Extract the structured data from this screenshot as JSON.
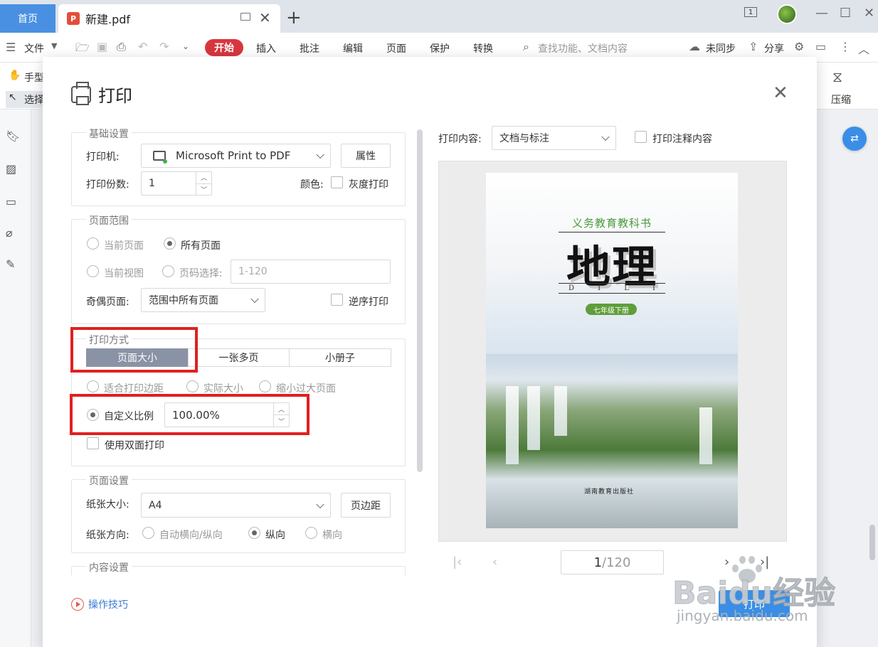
{
  "tabs": {
    "home": "首页",
    "doc_title": "新建.pdf",
    "pdf_icon": "P",
    "tab_count": "1"
  },
  "menu": {
    "file": "文件",
    "start": "开始",
    "items": [
      "插入",
      "批注",
      "编辑",
      "页面",
      "保护",
      "转换"
    ],
    "search_placeholder": "查找功能、文档内容",
    "sync": "未同步",
    "share": "分享"
  },
  "ribbon": {
    "hand": "手型",
    "select": "选择",
    "compress": "压缩"
  },
  "dialog": {
    "title": "打印",
    "basic": {
      "label": "基础设置",
      "printer_label": "打印机:",
      "printer_value": "Microsoft Print to PDF",
      "properties_button": "属性",
      "copies_label": "打印份数:",
      "copies_value": "1",
      "color_label": "颜色:",
      "grayscale": "灰度打印"
    },
    "range": {
      "label": "页面范围",
      "current_page": "当前页面",
      "all_pages": "所有页面",
      "current_view": "当前视图",
      "page_select": "页码选择:",
      "page_select_placeholder": "1-120",
      "odd_even_label": "奇偶页面:",
      "odd_even_value": "范围中所有页面",
      "reverse": "逆序打印"
    },
    "mode": {
      "label": "打印方式",
      "seg_page_size": "页面大小",
      "seg_multi": "一张多页",
      "seg_booklet": "小册子",
      "fit_margin": "适合打印边距",
      "actual_size": "实际大小",
      "shrink": "缩小过大页面",
      "custom_scale": "自定义比例",
      "scale_value": "100.00%",
      "duplex": "使用双面打印"
    },
    "page_setup": {
      "label": "页面设置",
      "paper_label": "纸张大小:",
      "paper_value": "A4",
      "margin_button": "页边距",
      "orient_label": "纸张方向:",
      "auto": "自动横向/纵向",
      "portrait": "纵向",
      "landscape": "横向"
    },
    "content": {
      "label": "内容设置"
    },
    "tips": "操作技巧",
    "print_content_label": "打印内容:",
    "print_content_value": "文档与标注",
    "print_comments": "打印注释内容",
    "page_current": "1",
    "page_total": "/120",
    "print_button": "打印"
  },
  "cover": {
    "subtitle": "义务教育教科书",
    "title": "地理",
    "pinyin": [
      "D",
      "I",
      "L",
      "I"
    ],
    "grade": "七年级下册",
    "publisher": "湖南教育出版社"
  },
  "watermark": {
    "logo": "Baidu经验",
    "url": "jingyan.baidu.com"
  }
}
